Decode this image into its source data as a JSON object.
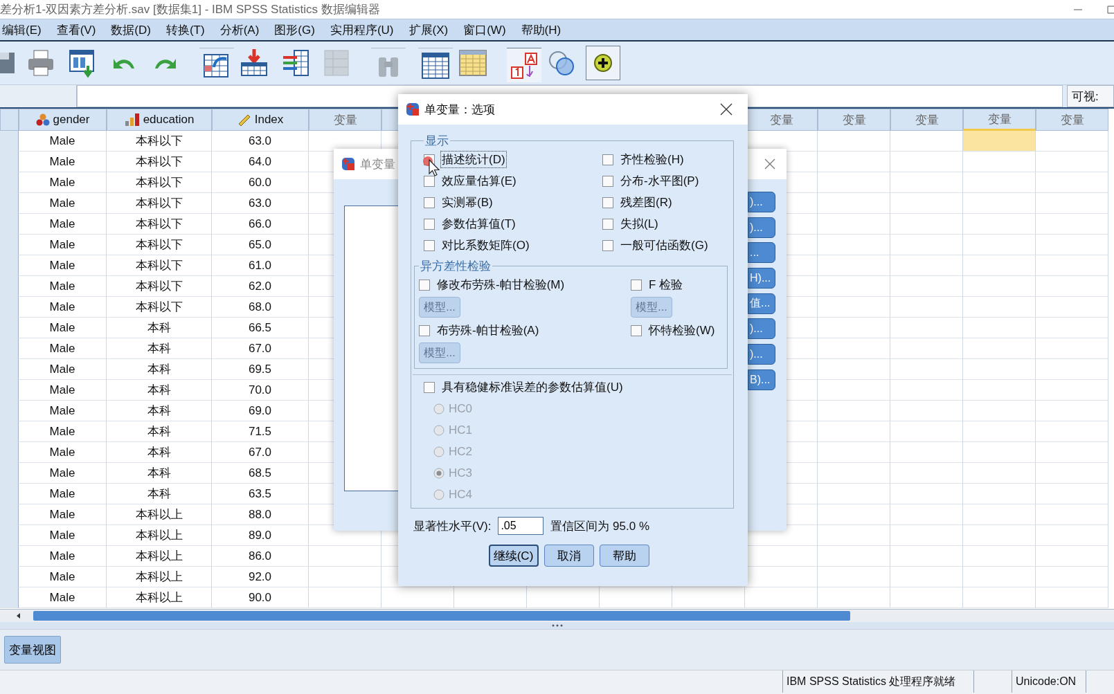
{
  "window": {
    "title": "差分析1-双因素方差分析.sav [数据集1] - IBM SPSS Statistics 数据编辑器"
  },
  "menu": [
    "编辑(E)",
    "查看(V)",
    "数据(D)",
    "转换(T)",
    "分析(A)",
    "图形(G)",
    "实用程序(U)",
    "扩展(X)",
    "窗口(W)",
    "帮助(H)"
  ],
  "toolbar": [
    {
      "kind": "save",
      "disabled": false,
      "pressed": false
    },
    {
      "kind": "print",
      "disabled": false,
      "pressed": false
    },
    {
      "kind": "goto-data",
      "disabled": false,
      "pressed": false
    },
    {
      "kind": "undo",
      "disabled": false,
      "pressed": false
    },
    {
      "kind": "redo",
      "disabled": false,
      "pressed": false
    },
    {
      "kind": "goto-case",
      "disabled": false,
      "pressed": false
    },
    {
      "kind": "insert-case",
      "disabled": false,
      "pressed": false
    },
    {
      "kind": "insert-variable",
      "disabled": false,
      "pressed": false
    },
    {
      "kind": "split",
      "disabled": true,
      "pressed": false
    },
    {
      "kind": "find",
      "disabled": true,
      "pressed": false
    },
    {
      "kind": "table",
      "disabled": false,
      "pressed": false
    },
    {
      "kind": "sheet",
      "disabled": false,
      "pressed": false
    },
    {
      "kind": "value-labels",
      "disabled": false,
      "pressed": true
    },
    {
      "kind": "sets",
      "disabled": false,
      "pressed": false
    },
    {
      "kind": "add",
      "disabled": false,
      "pressed": true
    }
  ],
  "cell_editor": {
    "visible_label": "可视:"
  },
  "grid": {
    "columns_left": [
      {
        "label": "gender",
        "kind": "nominal"
      },
      {
        "label": "education",
        "kind": "ordinal"
      },
      {
        "label": "Index",
        "kind": "scale"
      },
      {
        "label": "变量",
        "kind": "empty"
      }
    ],
    "columns_right": [
      {
        "label": "变量",
        "selected": false
      },
      {
        "label": "变量",
        "selected": false
      },
      {
        "label": "变量",
        "selected": false
      },
      {
        "label": "变量",
        "selected": true
      },
      {
        "label": "变量",
        "selected": false
      }
    ],
    "rows": [
      [
        "Male",
        "本科以下",
        "63.0"
      ],
      [
        "Male",
        "本科以下",
        "64.0"
      ],
      [
        "Male",
        "本科以下",
        "60.0"
      ],
      [
        "Male",
        "本科以下",
        "63.0"
      ],
      [
        "Male",
        "本科以下",
        "66.0"
      ],
      [
        "Male",
        "本科以下",
        "65.0"
      ],
      [
        "Male",
        "本科以下",
        "61.0"
      ],
      [
        "Male",
        "本科以下",
        "62.0"
      ],
      [
        "Male",
        "本科以下",
        "68.0"
      ],
      [
        "Male",
        "本科",
        "66.5"
      ],
      [
        "Male",
        "本科",
        "67.0"
      ],
      [
        "Male",
        "本科",
        "69.5"
      ],
      [
        "Male",
        "本科",
        "70.0"
      ],
      [
        "Male",
        "本科",
        "69.0"
      ],
      [
        "Male",
        "本科",
        "71.5"
      ],
      [
        "Male",
        "本科",
        "67.0"
      ],
      [
        "Male",
        "本科",
        "68.5"
      ],
      [
        "Male",
        "本科",
        "63.5"
      ],
      [
        "Male",
        "本科以上",
        "88.0"
      ],
      [
        "Male",
        "本科以上",
        "89.0"
      ],
      [
        "Male",
        "本科以上",
        "86.0"
      ],
      [
        "Male",
        "本科以上",
        "92.0"
      ],
      [
        "Male",
        "本科以上",
        "90.0"
      ]
    ]
  },
  "view_tabs": [
    {
      "label": "变量视图",
      "selected": false
    }
  ],
  "status_bar": {
    "processor": "IBM SPSS Statistics 处理程序就绪",
    "unicode": "Unicode:ON"
  },
  "background_dialog": {
    "title": "单变量",
    "buttons": [
      ")...",
      ")...",
      "...",
      "H)...",
      "值...",
      ")...",
      ")...",
      "B)..."
    ]
  },
  "options_dialog": {
    "title": "单变量：选项",
    "display_group": {
      "title": "显示",
      "items": [
        {
          "label": "描述统计(D)",
          "checked": false,
          "focused": true
        },
        {
          "label": "齐性检验(H)",
          "checked": false,
          "focused": false
        },
        {
          "label": "效应量估算(E)",
          "checked": false,
          "focused": false
        },
        {
          "label": "分布-水平图(P)",
          "checked": false,
          "focused": false
        },
        {
          "label": "实测幂(B)",
          "checked": false,
          "focused": false
        },
        {
          "label": "残差图(R)",
          "checked": false,
          "focused": false
        },
        {
          "label": "参数估算值(T)",
          "checked": false,
          "focused": false
        },
        {
          "label": "失拟(L)",
          "checked": false,
          "focused": false
        },
        {
          "label": "对比系数矩阵(O)",
          "checked": false,
          "focused": false
        },
        {
          "label": "一般可估函数(G)",
          "checked": false,
          "focused": false
        }
      ]
    },
    "hetero_group": {
      "title": "异方差性检验",
      "items": [
        {
          "label": "修改布劳殊-帕甘检验(M)",
          "checked": false,
          "model_button": {
            "label": "模型...",
            "disabled": true
          }
        },
        {
          "label": "F 检验",
          "checked": false,
          "model_button": {
            "label": "模型...",
            "disabled": true
          }
        },
        {
          "label": "布劳殊-帕甘检验(A)",
          "checked": false,
          "model_button": {
            "label": "模型...",
            "disabled": true
          }
        },
        {
          "label": "怀特检验(W)",
          "checked": false
        }
      ]
    },
    "robust": {
      "label": "具有稳健标准误差的参数估算值(U)",
      "checked": false,
      "options": [
        {
          "label": "HC0",
          "selected": false,
          "disabled": true
        },
        {
          "label": "HC1",
          "selected": false,
          "disabled": true
        },
        {
          "label": "HC2",
          "selected": false,
          "disabled": true
        },
        {
          "label": "HC3",
          "selected": true,
          "disabled": true
        },
        {
          "label": "HC4",
          "selected": false,
          "disabled": true
        }
      ]
    },
    "significance": {
      "label": "显著性水平(V):",
      "value": ".05",
      "confidence_text": "置信区间为 95.0 %"
    },
    "buttons": [
      {
        "label": "继续(C)",
        "default": true
      },
      {
        "label": "取消",
        "default": false
      },
      {
        "label": "帮助",
        "default": false
      }
    ]
  }
}
